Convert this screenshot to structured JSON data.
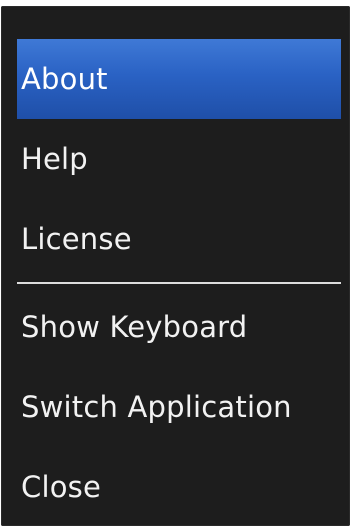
{
  "menu": {
    "items": [
      {
        "label": "About",
        "selected": true
      },
      {
        "label": "Help"
      },
      {
        "label": "License"
      },
      {
        "label": "Show Keyboard"
      },
      {
        "label": "Switch Application"
      },
      {
        "label": "Close"
      }
    ],
    "colors": {
      "background": "#1d1d1d",
      "selected": "#2a62c4",
      "text": "#f2f2f2",
      "divider": "#dcdcdc"
    }
  }
}
